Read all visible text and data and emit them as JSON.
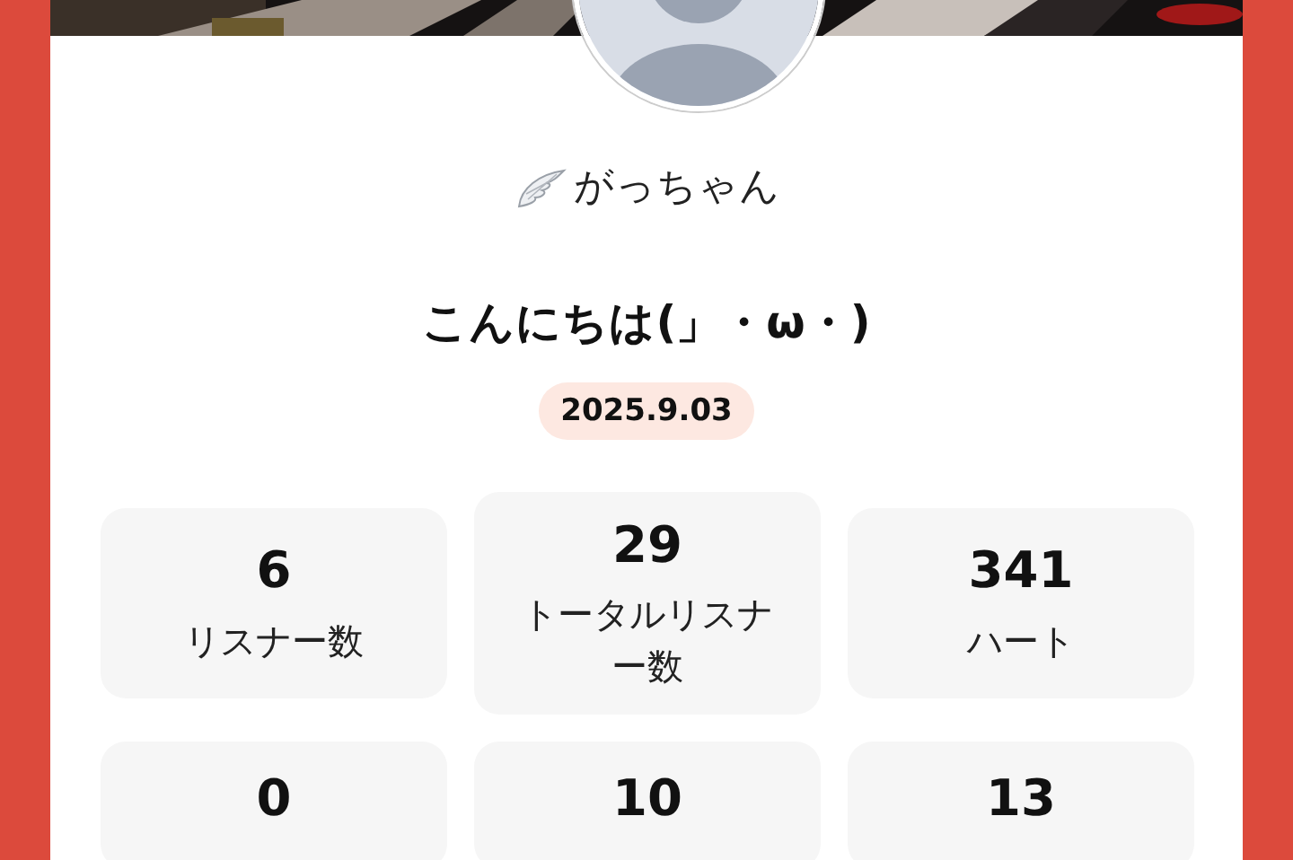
{
  "profile": {
    "name": "がっちゃん",
    "greeting": "こんにちは(」・ω・)",
    "date": "2025.9.03"
  },
  "stats": [
    {
      "value": "6",
      "label": "リスナー数"
    },
    {
      "value": "29",
      "label": "トータルリスナー数"
    },
    {
      "value": "341",
      "label": "ハート"
    },
    {
      "value": "0"
    },
    {
      "value": "10"
    },
    {
      "value": "13"
    }
  ]
}
